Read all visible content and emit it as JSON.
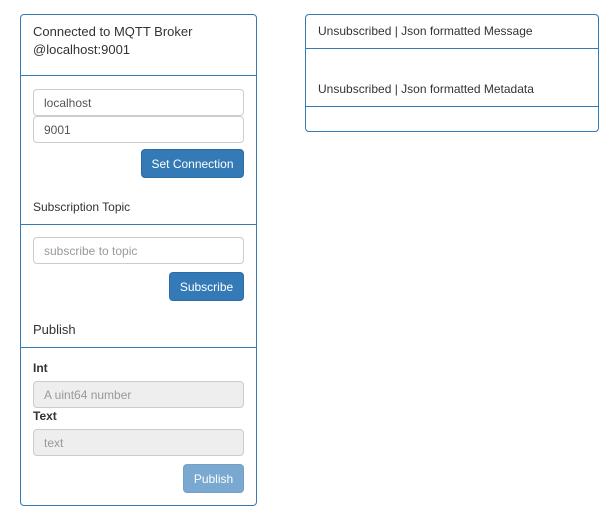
{
  "connection": {
    "status_title": "Connected to MQTT Broker @localhost:9001",
    "host_value": "localhost",
    "port_value": "9001",
    "set_button": "Set Connection"
  },
  "subscription": {
    "label": "Subscription Topic",
    "placeholder": "subscribe to topic",
    "button": "Subscribe"
  },
  "publish": {
    "label": "Publish",
    "int_label": "Int",
    "int_placeholder": "A uint64 number",
    "text_label": "Text",
    "text_placeholder": "text",
    "button": "Publish"
  },
  "output": {
    "message_header": "Unsubscribed | Json formatted Message",
    "metadata_header": "Unsubscribed | Json formatted Metadata"
  },
  "colors": {
    "primary": "#337ab7",
    "border": "#337ab7"
  }
}
